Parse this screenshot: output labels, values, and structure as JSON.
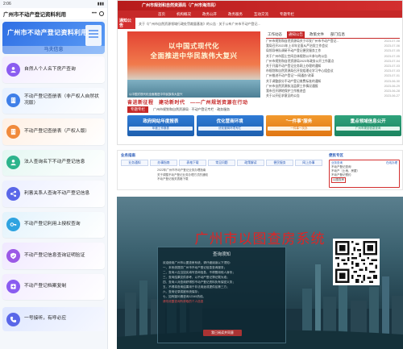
{
  "phone": {
    "status_time": "2:06",
    "app_title": "广州市不动产登记资料利用",
    "banner_title": "广州市不动产登记资料利用",
    "banner_sub": "马夫信息",
    "menu": [
      {
        "label": "自然人个人名下房产查询",
        "icon": "person-icon"
      },
      {
        "label": "不动产登记查册表（非产权人自然状况版）",
        "icon": "building-icon"
      },
      {
        "label": "不动产登记查册表（产权人版）",
        "icon": "building-icon"
      },
      {
        "label": "法人查询名下不动产登记信息",
        "icon": "person-icon"
      },
      {
        "label": "利害关系人查询不动产登记信息",
        "icon": "share-icon"
      },
      {
        "label": "不动产登记利用上授权查询",
        "icon": "key-icon"
      },
      {
        "label": "不动产登记信息查询证明验证",
        "icon": "shield-check-icon"
      },
      {
        "label": "不动产登记档案复制",
        "icon": "copy-plus-icon"
      }
    ],
    "hotline": "一号接听，有呼必应"
  },
  "site": {
    "header": "广州市规划和自然资源局（广州市海洋局）",
    "nav": [
      "首页",
      "机构概况",
      "政务公开",
      "政务服务",
      "互动交流",
      "专题专栏"
    ],
    "notice_tag": "通知公告",
    "notice_text": "关于《广州市自然资源领域行政处罚裁量基准》的公告  ·  关于公布广州市不动产登记...",
    "hero_l1": "以中国式现代化",
    "hero_l2": "全面推进中华民族伟大复兴",
    "hero_caption": "以中国式现代化全面推进中华民族伟大复兴",
    "slogan": "奋进新征程　建功新时代　——广州规划资源在行动",
    "news_tabs": [
      "工作动态",
      "通知公告",
      "政策文件",
      "部门信息"
    ],
    "news_items": [
      {
        "t": "广州市规划和自然资源局关于印发广州市不动产登记...",
        "d": "2023-07-08"
      },
      {
        "t": "我局召开2023年上半年全面从严治党工作会议",
        "d": "2023-07-06"
      },
      {
        "t": "局领导带队调研不动产登记便民服务工作",
        "d": "2023-07-05"
      },
      {
        "t": "关于广州市国土空间总体规划公众参与的公告",
        "d": "2023-07-05"
      },
      {
        "t": "广州市规划和自然资源局2023年政务公开工作要点",
        "d": "2023-07-04"
      },
      {
        "t": "关于开展不动产登记业务网上办理的通知",
        "d": "2023-07-03"
      },
      {
        "t": "市规划和自然资源局召开党组理论学习中心组会议",
        "d": "2023-07-03"
      },
      {
        "t": "广州推进不动产登记\"一网通办\"改革",
        "d": "2023-07-01"
      },
      {
        "t": "关于调整部分不动产登记收费标准的通知",
        "d": "2023-06-30"
      },
      {
        "t": "广州市自然资源执法监察工作情况通报",
        "d": "2023-06-29"
      },
      {
        "t": "我市召开耕地保护工作推进会",
        "d": "2023-06-28"
      },
      {
        "t": "关于公开征求意见的公告",
        "d": "2023-06-27"
      }
    ],
    "lower_tag": "专题专栏",
    "lower_text": "广州市规划和自然资源局  ·  不动产登记专栏  ·  政务服务",
    "services": [
      {
        "title": "政府网站年度报表",
        "sub": "年度工作报表",
        "tone": "blue"
      },
      {
        "title": "优化营商环境",
        "sub": "优化营商环境专栏",
        "tone": "blue"
      },
      {
        "title": "\"一件事\"服务",
        "sub": "一件事一次办",
        "tone": "orange"
      },
      {
        "title": "重点领域信息公开",
        "sub": "广州市规划信息查询",
        "tone": "green"
      }
    ]
  },
  "portal": {
    "left_head": "业务指南",
    "tabs": [
      "业务通知",
      "办事指南",
      "表格下载",
      "常见问题",
      "政策解读",
      "便民服务",
      "网上办事"
    ],
    "lines": [
      "2022年广州市不动产登记业务办理指南",
      "关于调整不动产登记业务办理方式的通知",
      "不动产登记相关表格下载"
    ],
    "right_head": "便民专区",
    "right_top_left": "业务查询",
    "right_top_right": "在线办理",
    "right_items": [
      "不动产登记查询",
      "不动产（土地、房屋）",
      "不动产登记预约",
      "以图查房"
    ],
    "highlight": "以图查房"
  },
  "query": {
    "title": "广州市以图查房系统",
    "dialog_title": "查询须知",
    "dialog_lines": [
      "欢迎使用广州市以图查房系统，请仔细阅读以下须知：",
      "一、本系统提供广州市不动产登记信息查询服务；",
      "二、查询人应当如实填写查询信息，不得冒用他人身份；",
      "三、查询结果仅供参考，以不动产登记簿记载为准；",
      "四、查询人对查询获得的不动产登记资料负有保密义务；",
      "五、不得将查询结果用于非法用途或提供给第三方；",
      "六、查询记录将被系统保存；",
      "七、如有疑问请咨询12345热线。"
    ],
    "dialog_warning": "请勿泄露查询所获取的个人信息",
    "dialog_button": "我已阅读并同意"
  }
}
